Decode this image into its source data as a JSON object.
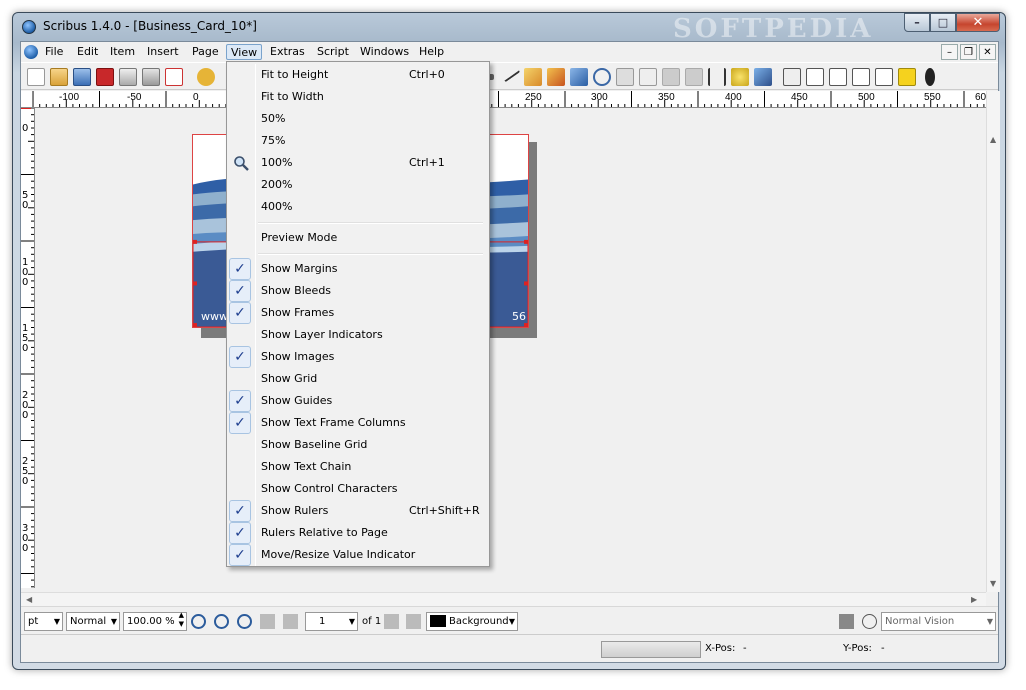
{
  "window": {
    "title": "Scribus 1.4.0 - [Business_Card_10*]",
    "watermark": "SOFTPEDIA"
  },
  "window_controls": {
    "minimize": "–",
    "maximize": "□",
    "close": "✕"
  },
  "mdi_controls": {
    "minimize": "–",
    "restore": "❐",
    "close": "✕"
  },
  "menubar": {
    "file": "File",
    "edit": "Edit",
    "item": "Item",
    "insert": "Insert",
    "page": "Page",
    "view": "View",
    "extras": "Extras",
    "script": "Script",
    "windows": "Windows",
    "help": "Help"
  },
  "ruler": {
    "h_labels": [
      "-100",
      "-50",
      "0",
      "250",
      "300",
      "350",
      "400",
      "450",
      "500",
      "550",
      "60"
    ],
    "v_labels": [
      "0",
      "5 0",
      "1 0 0",
      "1 5 0",
      "2 0 0",
      "2 5 0",
      "3 0 0"
    ]
  },
  "document": {
    "url_text": "www.sof",
    "num_text": "56"
  },
  "view_menu": {
    "fit_to_height": {
      "label": "Fit to Height",
      "shortcut": "Ctrl+0"
    },
    "fit_to_width": {
      "label": "Fit to Width"
    },
    "zoom_50": {
      "label": "50%"
    },
    "zoom_75": {
      "label": "75%"
    },
    "zoom_100": {
      "label": "100%",
      "shortcut": "Ctrl+1"
    },
    "zoom_200": {
      "label": "200%"
    },
    "zoom_400": {
      "label": "400%"
    },
    "preview_mode": {
      "label": "Preview Mode"
    },
    "show_margins": {
      "label": "Show Margins",
      "checked": true
    },
    "show_bleeds": {
      "label": "Show Bleeds",
      "checked": true
    },
    "show_frames": {
      "label": "Show Frames",
      "checked": true
    },
    "show_layer_indicators": {
      "label": "Show Layer Indicators",
      "checked": false
    },
    "show_images": {
      "label": "Show Images",
      "checked": true
    },
    "show_grid": {
      "label": "Show Grid",
      "checked": false
    },
    "show_guides": {
      "label": "Show Guides",
      "checked": true
    },
    "show_text_frame_columns": {
      "label": "Show Text Frame Columns",
      "checked": true
    },
    "show_baseline_grid": {
      "label": "Show Baseline Grid",
      "checked": false
    },
    "show_text_chain": {
      "label": "Show Text Chain",
      "checked": false
    },
    "show_control_characters": {
      "label": "Show Control Characters",
      "checked": false
    },
    "show_rulers": {
      "label": "Show Rulers",
      "shortcut": "Ctrl+Shift+R",
      "checked": true
    },
    "rulers_relative": {
      "label": "Rulers Relative to Page",
      "checked": true
    },
    "move_resize_indicator": {
      "label": "Move/Resize Value Indicator",
      "checked": true
    },
    "check_glyph": "✓"
  },
  "statusbar": {
    "unit": "pt",
    "preview_quality": "Normal",
    "zoom": "100.00 %",
    "page_number": "1",
    "page_of": "of 1",
    "layer": "Background",
    "vision": "Normal Vision",
    "xpos_label": "X-Pos:",
    "xpos_value": "-",
    "ypos_label": "Y-Pos:",
    "ypos_value": "-"
  },
  "colors": {
    "accent_blue": "#2f5fa6",
    "card_dark_blue": "#3a5a95",
    "selection_red": "#dd2222",
    "check_blue": "#1f3f8f"
  }
}
